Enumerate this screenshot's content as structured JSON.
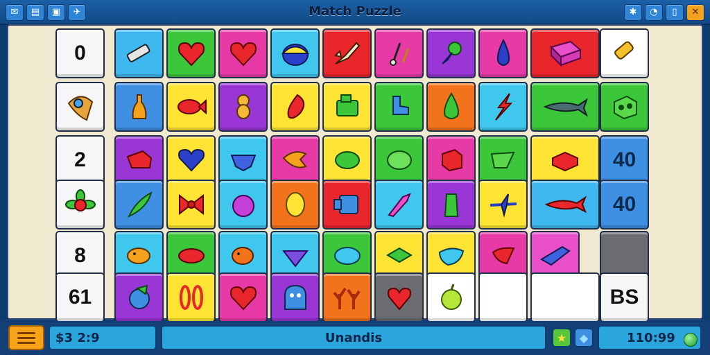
{
  "window": {
    "title": "Match Puzzle",
    "left_buttons": [
      "✉",
      "▤",
      "▣",
      "✈"
    ],
    "right_buttons": [
      "✱",
      "◔",
      "▯",
      "✕"
    ]
  },
  "board": {
    "numbers": {
      "r0": "0",
      "r2": "2",
      "r4": "8",
      "r5": "61",
      "blue1": "40",
      "blue2": "40",
      "corner": "BS"
    },
    "tiles": [
      {
        "color": "#3fb8ef",
        "icon": "crayon-icon"
      },
      {
        "color": "#3cc63a",
        "icon": "heart-icon"
      },
      {
        "color": "#e83aa7",
        "icon": "heart-icon"
      },
      {
        "color": "#3fc7ee",
        "icon": "egg-icon"
      },
      {
        "color": "#e8262c",
        "icon": "rocket-icon"
      },
      {
        "color": "#e83aa7",
        "icon": "pins-icon"
      },
      {
        "color": "#9a35d6",
        "icon": "lamp-icon"
      },
      {
        "color": "#e83aa7",
        "icon": "drop-icon"
      },
      {
        "color": "#e8262c",
        "icon": "book-icon"
      },
      {
        "color": "#ffffff",
        "icon": "bottle-icon"
      },
      {
        "color": "#3f8fe3",
        "icon": "bottle-icon"
      },
      {
        "color": "#fde333",
        "icon": "fish-icon"
      },
      {
        "color": "#9a35d6",
        "icon": "shell-icon"
      },
      {
        "color": "#fde333",
        "icon": "leaf-icon"
      },
      {
        "color": "#fde333",
        "icon": "tank-icon"
      },
      {
        "color": "#3cc63a",
        "icon": "boot-icon"
      },
      {
        "color": "#f3731d",
        "icon": "drop-icon"
      },
      {
        "color": "#3fc7ee",
        "icon": "lightning-icon"
      },
      {
        "color": "#3cc63a",
        "icon": "shark-icon"
      },
      {
        "color": "#3cc63a",
        "icon": "crate-icon"
      }
    ]
  },
  "bottom": {
    "score_label": "$3 2:9",
    "status": "Unandis",
    "time": "110:99",
    "star_icon": "star-icon",
    "diamond_icon": "diamond-icon"
  }
}
